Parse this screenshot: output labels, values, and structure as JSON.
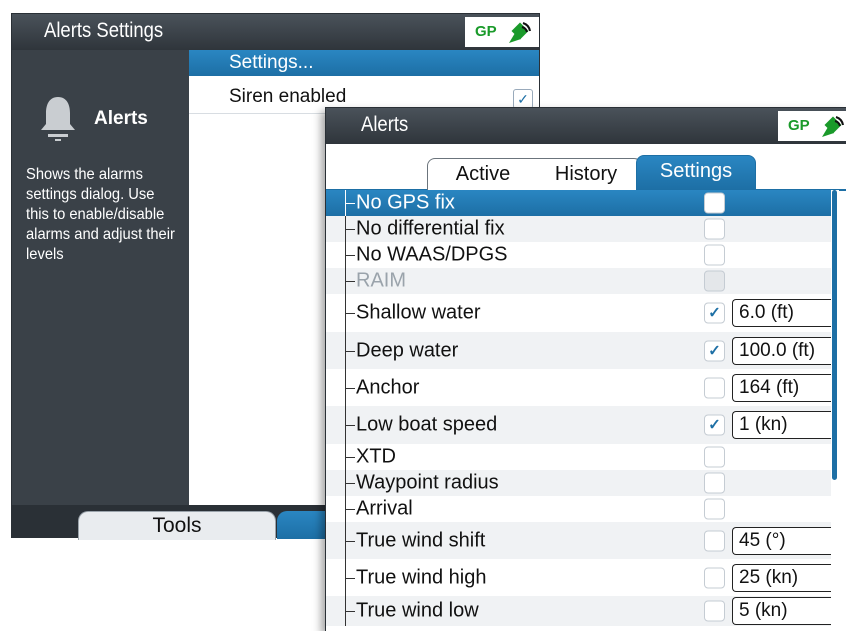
{
  "back_window": {
    "title": "Alerts Settings",
    "gps_label": "GP",
    "side_title": "Alerts",
    "side_description": "Shows the alarms settings dialog. Use this to enable/disable alarms and adjust their levels",
    "menu": [
      {
        "label": "Settings...",
        "selected": true
      },
      {
        "label": "Siren enabled",
        "checked": true
      }
    ],
    "bottom_tab": "Tools"
  },
  "front_window": {
    "title": "Alerts",
    "gps_label": "GP",
    "tabs": [
      "Active",
      "History",
      "Settings"
    ],
    "active_tab": "Settings",
    "rows": [
      {
        "label": "No GPS fix",
        "checked": false,
        "value": "",
        "selected": true
      },
      {
        "label": "No differential fix",
        "checked": false,
        "value": ""
      },
      {
        "label": "No WAAS/DPGS",
        "checked": false,
        "value": ""
      },
      {
        "label": "RAIM",
        "checked": false,
        "value": "",
        "disabled": true
      },
      {
        "label": "Shallow water",
        "checked": true,
        "value": "6.0 (ft)"
      },
      {
        "label": "Deep water",
        "checked": true,
        "value": "100.0 (ft)"
      },
      {
        "label": "Anchor",
        "checked": false,
        "value": "164 (ft)"
      },
      {
        "label": "Low boat speed",
        "checked": true,
        "value": "1 (kn)"
      },
      {
        "label": "XTD",
        "checked": false,
        "value": ""
      },
      {
        "label": "Waypoint radius",
        "checked": false,
        "value": ""
      },
      {
        "label": "Arrival",
        "checked": false,
        "value": ""
      },
      {
        "label": "True wind shift",
        "checked": false,
        "value": "45 (°)"
      },
      {
        "label": "True wind high",
        "checked": false,
        "value": "25 (kn)"
      },
      {
        "label": "True wind low",
        "checked": false,
        "value": "5 (kn)"
      }
    ]
  },
  "colors": {
    "selection_blue": "#1d6fa5",
    "titlebar": "#2f353b",
    "side_panel": "#3a4148",
    "gps_green": "#1a9a2a"
  },
  "icons": {
    "bell": "bell-icon",
    "satellite": "satellite-icon",
    "check": "checkmark-icon"
  }
}
